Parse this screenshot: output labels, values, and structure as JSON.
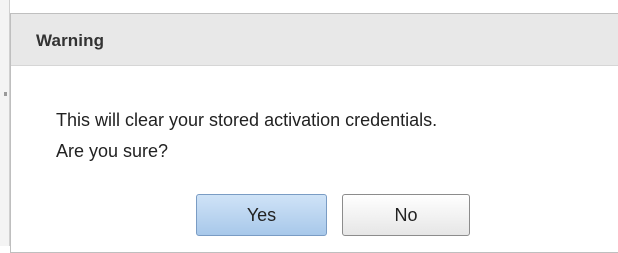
{
  "dialog": {
    "title": "Warning",
    "message_line1": "This will clear your stored activation credentials.",
    "message_line2": "Are you sure?",
    "buttons": {
      "yes": "Yes",
      "no": "No"
    }
  },
  "colors": {
    "titlebar_bg": "#e8e8e8",
    "yes_button_bg": "#b8d4f0",
    "no_button_bg": "#f2f2f2"
  }
}
